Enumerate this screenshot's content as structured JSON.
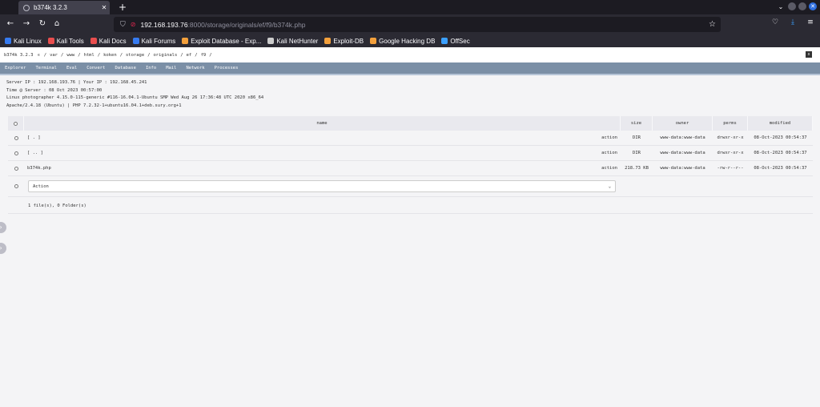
{
  "browser": {
    "tab_title": "b374k 3.2.3",
    "url_host": "192.168.193.76",
    "url_path": ":8000/storage/originals/ef/f9/b374k.php",
    "bookmarks": [
      {
        "label": "Kali Linux",
        "icon": "kali-icon",
        "color": "#367bf0"
      },
      {
        "label": "Kali Tools",
        "icon": "kali-tools-icon",
        "color": "#e94e4e"
      },
      {
        "label": "Kali Docs",
        "icon": "kali-docs-icon",
        "color": "#e94e4e"
      },
      {
        "label": "Kali Forums",
        "icon": "kali-forums-icon",
        "color": "#367bf0"
      },
      {
        "label": "Exploit Database - Exp...",
        "icon": "exploit-db-icon",
        "color": "#f3a03c"
      },
      {
        "label": "Kali NetHunter",
        "icon": "nethunter-icon",
        "color": "#cccccc"
      },
      {
        "label": "Exploit-DB",
        "icon": "exploit-db-icon",
        "color": "#f3a03c"
      },
      {
        "label": "Google Hacking DB",
        "icon": "ghdb-icon",
        "color": "#f3a03c"
      },
      {
        "label": "OffSec",
        "icon": "offsec-icon",
        "color": "#3ba0ff"
      }
    ]
  },
  "shell": {
    "name": "b374k 3.2.3",
    "breadcrumb": [
      "/",
      "var",
      "/",
      "www",
      "/",
      "html",
      "/",
      "koken",
      "/",
      "storage",
      "/",
      "originals",
      "/",
      "ef",
      "/",
      "f9",
      "/"
    ],
    "close_label": "x",
    "menu": [
      "Explorer",
      "Terminal",
      "Eval",
      "Convert",
      "Database",
      "Info",
      "Mail",
      "Network",
      "Processes"
    ],
    "info_lines": [
      "Server IP : 192.168.193.76 | Your IP : 192.168.45.241",
      "Time @ Server : 08 Oct 2023 00:57:00",
      "Linux photographer 4.15.0-115-generic #116-16.04.1-Ubuntu SMP Wed Aug 26 17:36:48 UTC 2020 x86_64",
      "Apache/2.4.18 (Ubuntu) | PHP 7.2.32-1+ubuntu16.04.1+deb.sury.org+1"
    ],
    "columns": {
      "name": "name",
      "size": "size",
      "owner": "owner",
      "perms": "perms",
      "modified": "modified"
    },
    "rows": [
      {
        "name": "[ . ]",
        "action": "action",
        "size": "DIR",
        "owner": "www-data:www-data",
        "perms": "drwxr-xr-x",
        "modified": "08-Oct-2023 00:54:37"
      },
      {
        "name": "[ .. ]",
        "action": "action",
        "size": "DIR",
        "owner": "www-data:www-data",
        "perms": "drwxr-xr-x",
        "modified": "08-Oct-2023 00:54:37"
      },
      {
        "name": "b374k.php",
        "action": "action",
        "size": "218.73 KB",
        "owner": "www-data:www-data",
        "perms": "-rw-r--r--",
        "modified": "08-Oct-2023 00:54:37"
      }
    ],
    "action_select": "Action",
    "summary": "1 file(s), 0 Folder(s)"
  }
}
